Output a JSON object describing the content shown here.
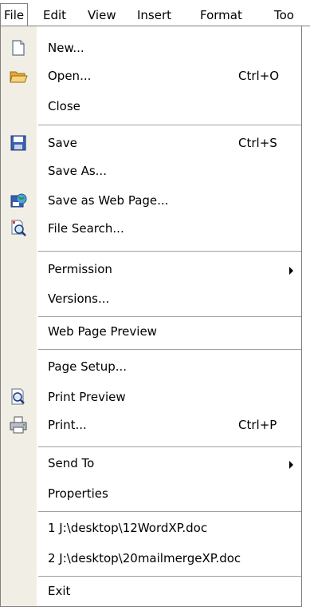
{
  "menubar": {
    "items": [
      {
        "label": "File",
        "mnemonic": "F"
      },
      {
        "label": "Edit",
        "mnemonic": "E"
      },
      {
        "label": "View",
        "mnemonic": "V"
      },
      {
        "label": "Insert",
        "mnemonic": "I"
      },
      {
        "label": "Format",
        "mnemonic": "o"
      },
      {
        "label": "Too",
        "mnemonic": "T"
      }
    ]
  },
  "file_menu": {
    "items": [
      {
        "label": "New...",
        "icon": "new-document-icon"
      },
      {
        "label": "Open...",
        "shortcut": "Ctrl+O",
        "icon": "open-folder-icon"
      },
      {
        "label": "Close"
      },
      {
        "label": "Save",
        "shortcut": "Ctrl+S",
        "icon": "save-disk-icon"
      },
      {
        "label": "Save As..."
      },
      {
        "label": "Save as Web Page...",
        "icon": "save-web-page-icon"
      },
      {
        "label": "File Search...",
        "icon": "file-search-icon"
      },
      {
        "label": "Permission",
        "submenu": true
      },
      {
        "label": "Versions..."
      },
      {
        "label": "Web Page Preview"
      },
      {
        "label": "Page Setup..."
      },
      {
        "label": "Print Preview",
        "icon": "print-preview-icon"
      },
      {
        "label": "Print...",
        "shortcut": "Ctrl+P",
        "icon": "printer-icon"
      },
      {
        "label": "Send To",
        "submenu": true
      },
      {
        "label": "Properties"
      },
      {
        "label": "1 J:\\desktop\\12WordXP.doc"
      },
      {
        "label": "2 J:\\desktop\\20mailmergeXP.doc"
      },
      {
        "label": "Exit"
      }
    ]
  }
}
